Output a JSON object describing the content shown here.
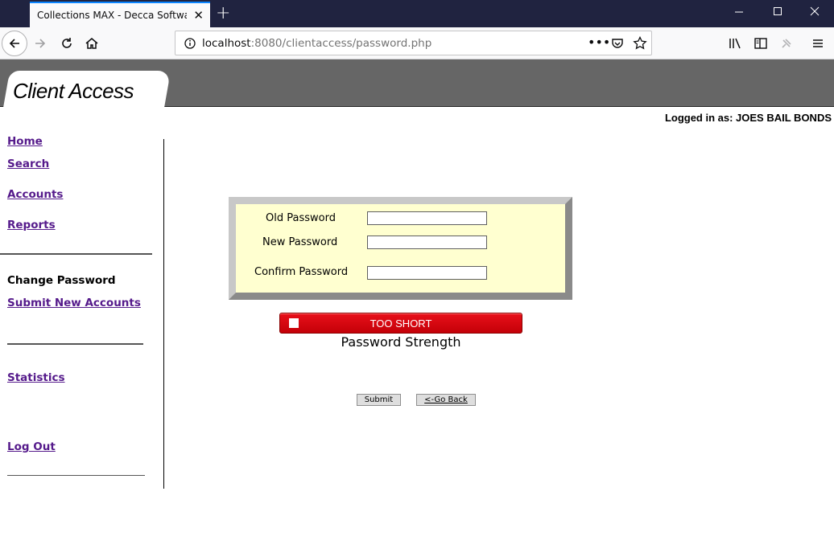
{
  "browser": {
    "tab_title": "Collections MAX - Decca Software C",
    "url_host": "localhost",
    "url_rest": ":8080/clientaccess/password.php"
  },
  "header": {
    "brand": "Client Access",
    "logged_in": "Logged in as: JOES BAIL BONDS"
  },
  "sidebar": {
    "home": "Home",
    "search": "Search",
    "accounts": "Accounts",
    "reports": "Reports",
    "change_password": "Change Password",
    "submit_new_accounts": "Submit New Accounts",
    "statistics": "Statistics",
    "log_out": "Log Out"
  },
  "form": {
    "old_password_label": "Old Password",
    "new_password_label": "New Password",
    "confirm_password_label": "Confirm Password",
    "old_password_value": "",
    "new_password_value": "",
    "confirm_password_value": ""
  },
  "strength": {
    "status": "TOO SHORT",
    "caption": "Password Strength",
    "color": "#d4000c"
  },
  "buttons": {
    "submit": "Submit",
    "go_back": "<-Go Back"
  }
}
